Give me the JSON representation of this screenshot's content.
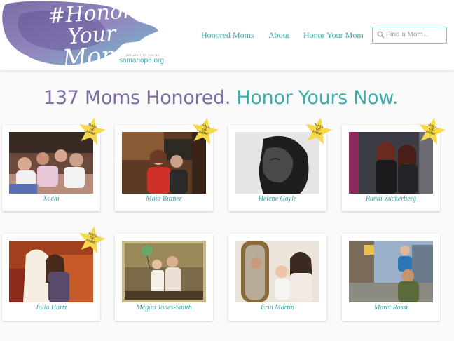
{
  "logo": {
    "text_line1": "#Honor Your",
    "text_line2": "Mom",
    "byline": "BROUGHT TO YOU BY",
    "org": "samahope.org"
  },
  "nav": [
    {
      "label": "Honored Moms"
    },
    {
      "label": "About"
    },
    {
      "label": "Honor Your Mom"
    }
  ],
  "search": {
    "placeholder": "Find a Mom..."
  },
  "headline": {
    "part1": "137 Moms Honored.",
    "part2": "Honor Yours Now."
  },
  "badge_label": "HALL OF FAME",
  "colors": {
    "brand_purple": "#7e6ca4",
    "brand_teal": "#3eaead",
    "badge_yellow": "#f6d94a"
  },
  "moms": [
    {
      "name": "Xochi",
      "hall_of_fame": true
    },
    {
      "name": "Maia Bittner",
      "hall_of_fame": true
    },
    {
      "name": "Helene Gayle",
      "hall_of_fame": true
    },
    {
      "name": "Randi Zuckerberg",
      "hall_of_fame": true
    },
    {
      "name": "Julia Hartz",
      "hall_of_fame": true
    },
    {
      "name": "Megan Jones-Smith",
      "hall_of_fame": false
    },
    {
      "name": "Erin Martin",
      "hall_of_fame": false
    },
    {
      "name": "Maret Rossi",
      "hall_of_fame": false
    }
  ]
}
